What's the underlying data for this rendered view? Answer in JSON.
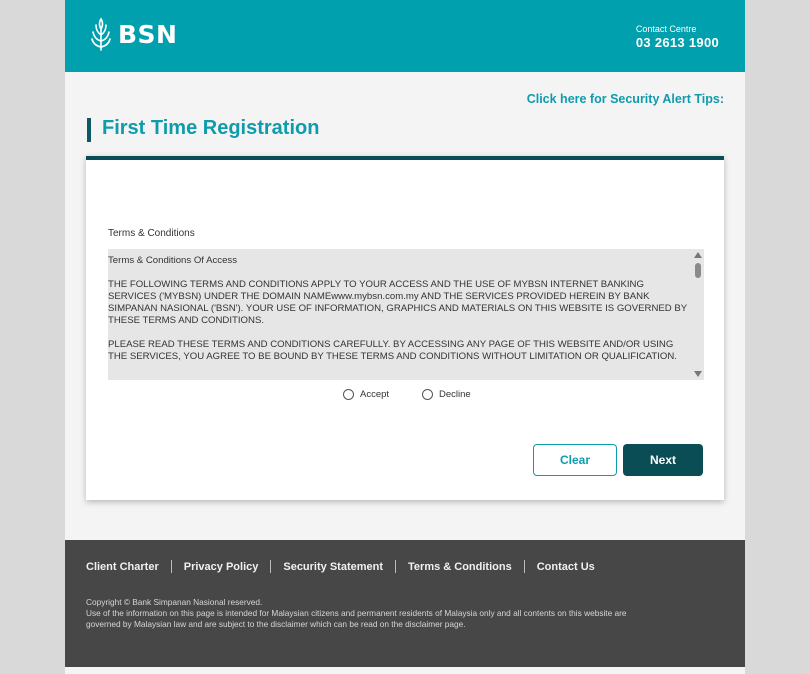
{
  "header": {
    "logo_text": "BSN",
    "contact_label": "Contact Centre",
    "contact_number": "03 2613 1900"
  },
  "security_link": "Click here for Security Alert Tips:",
  "page_title": "First Time Registration",
  "terms": {
    "label": "Terms & Conditions",
    "heading": "Terms & Conditions Of Access",
    "paragraphs": [
      "THE FOLLOWING TERMS AND CONDITIONS APPLY TO YOUR ACCESS AND THE USE OF MYBSN INTERNET BANKING SERVICES ('MYBSN) UNDER THE DOMAIN NAMEwww.mybsn.com.my AND THE SERVICES PROVIDED HEREIN BY BANK SIMPANAN NASIONAL ('BSN'). YOUR USE OF INFORMATION, GRAPHICS AND MATERIALS ON THIS WEBSITE IS GOVERNED BY THESE TERMS AND CONDITIONS.",
      "PLEASE READ THESE TERMS AND CONDITIONS CAREFULLY. BY ACCESSING ANY PAGE OF THIS WEBSITE AND/OR USING THE SERVICES, YOU AGREE TO BE BOUND BY THESE TERMS AND CONDITIONS WITHOUT LIMITATION OR QUALIFICATION."
    ]
  },
  "options": {
    "accept": "Accept",
    "decline": "Decline"
  },
  "buttons": {
    "clear": "Clear",
    "next": "Next"
  },
  "footer": {
    "links": [
      "Client Charter",
      "Privacy Policy",
      "Security Statement",
      "Terms & Conditions",
      "Contact Us"
    ],
    "copyright": "Copyright © Bank Simpanan Nasional reserved.",
    "disclaimer": "Use of the information on this page is intended for Malaysian citizens and permanent residents of Malaysia only and all contents on this website are governed by Malaysian law and are subject to the disclaimer which can be read on the disclaimer page."
  },
  "colors": {
    "header_teal": "#00a0af",
    "accent_dark": "#0b4d55",
    "footer_bg": "#474747"
  }
}
